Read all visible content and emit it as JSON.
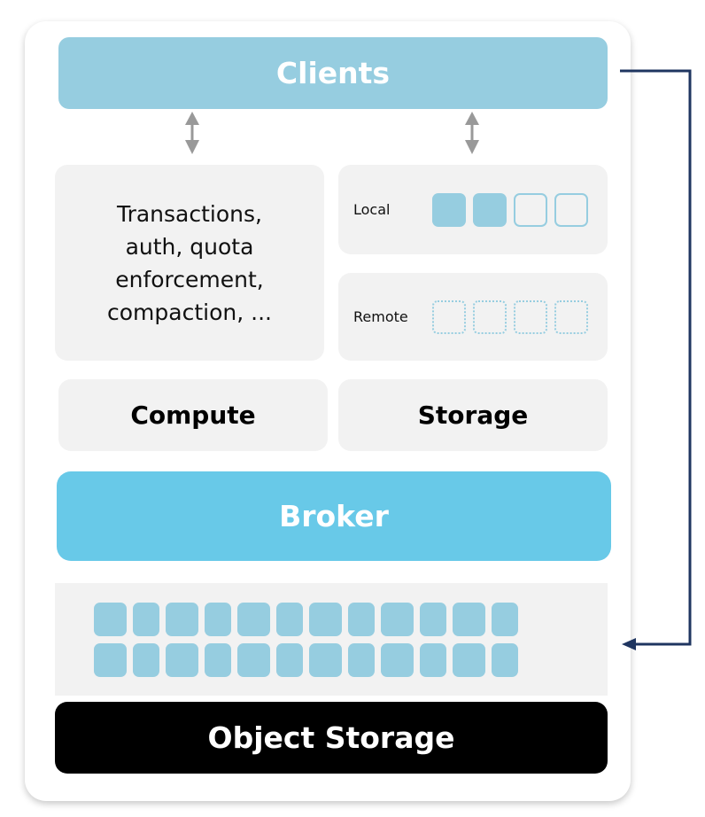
{
  "diagram": {
    "colors": {
      "clients": "#96cde0",
      "broker": "#68c9e8",
      "panel": "#f2f2f2",
      "object_storage": "#000000",
      "arrow_gray": "#999999",
      "connector": "#1f3560",
      "slot": "#96cde0"
    },
    "clients": {
      "label": "Clients"
    },
    "compute_description": {
      "lines": [
        "Transactions,",
        "auth, quota",
        "enforcement,",
        "compaction, ..."
      ]
    },
    "storage_tiers": {
      "local": {
        "label": "Local",
        "slots": [
          "filled",
          "filled",
          "empty",
          "empty"
        ]
      },
      "remote": {
        "label": "Remote",
        "slots": [
          "dotted",
          "dotted",
          "dotted",
          "dotted"
        ]
      }
    },
    "compute_label": "Compute",
    "storage_label": "Storage",
    "broker": {
      "label": "Broker"
    },
    "object_grid": {
      "rows": 2,
      "columns": 12
    },
    "object_storage": {
      "label": "Object Storage"
    },
    "connections": [
      {
        "from": "clients",
        "to": "compute",
        "type": "bidirectional"
      },
      {
        "from": "clients",
        "to": "storage",
        "type": "bidirectional"
      },
      {
        "from": "clients",
        "to": "object-grid",
        "type": "directed"
      }
    ]
  }
}
